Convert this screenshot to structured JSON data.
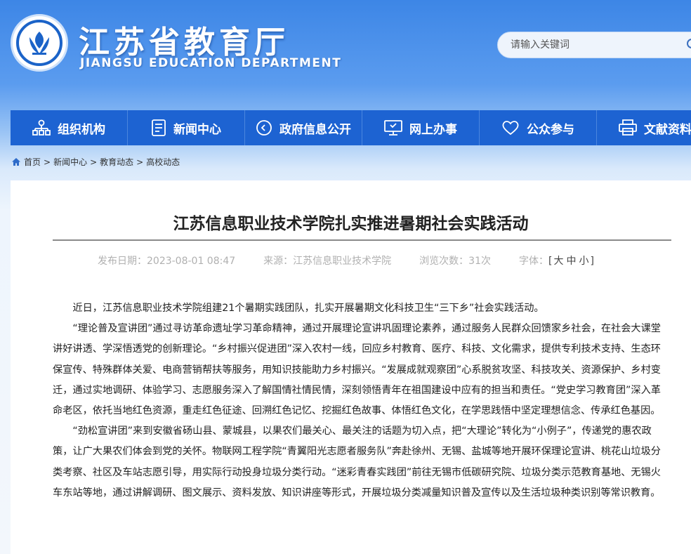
{
  "header": {
    "site_title": "江苏省教育厅",
    "site_subtitle": "JIANGSU EDUCATION DEPARTMENT",
    "search_placeholder": "请输入关键词"
  },
  "nav": [
    {
      "label": "组织机构",
      "icon": "org-chart-icon"
    },
    {
      "label": "新闻中心",
      "icon": "document-icon"
    },
    {
      "label": "政府信息公开",
      "icon": "play-circle-icon"
    },
    {
      "label": "网上办事",
      "icon": "monitor-icon"
    },
    {
      "label": "公众参与",
      "icon": "heart-icon"
    },
    {
      "label": "文献资料",
      "icon": "printer-icon"
    }
  ],
  "breadcrumb": {
    "items": [
      "首页",
      "新闻中心",
      "教育动态",
      "高校动态"
    ],
    "separator": ">"
  },
  "article": {
    "title": "江苏信息职业技术学院扎实推进暑期社会实践活动",
    "publish_label": "发布日期：",
    "publish_date": "2023-08-01 08:47",
    "source_label": "来源：",
    "source": "江苏信息职业技术学院",
    "views_label": "浏览次数：",
    "views": "31次",
    "font_label": "字体：",
    "font_sizes": [
      "大",
      "中",
      "小"
    ],
    "paragraphs": [
      "近日，江苏信息职业技术学院组建21个暑期实践团队，扎实开展暑期文化科技卫生“三下乡”社会实践活动。",
      "“理论普及宣讲团”通过寻访革命遗址学习革命精神，通过开展理论宣讲巩固理论素养，通过服务人民群众回馈家乡社会，在社会大课堂讲好讲透、学深悟透党的创新理论。“乡村振兴促进团”深入农村一线，回应乡村教育、医疗、科技、文化需求，提供专利技术支持、生态环保宣传、特殊群体关爱、电商营销帮扶等服务，用知识技能助力乡村振兴。“发展成就观察团”心系脱贫攻坚、科技攻关、资源保护、乡村变迁，通过实地调研、体验学习、志愿服务深入了解国情社情民情，深刻领悟青年在祖国建设中应有的担当和责任。“党史学习教育团”深入革命老区，依托当地红色资源，重走红色征途、回溯红色记忆、挖掘红色故事、体悟红色文化，在学思践悟中坚定理想信念、传承红色基因。",
      "“劲松宣讲团”来到安徽省砀山县、蒙城县，以果农们最关心、最关注的话题为切入点，把“大理论”转化为“小例子”，传递党的惠农政策，让广大果农们体会到党的关怀。物联网工程学院“青翼阳光志愿者服务队”奔赴徐州、无锡、盐城等地开展环保理论宣讲、桃花山垃圾分类考察、社区及车站志愿引导，用实际行动投身垃圾分类行动。“迷彩青春实践团”前往无锡市低碳研究院、垃圾分类示范教育基地、无锡火车东站等地，通过讲解调研、图文展示、资料发放、知识讲座等形式，开展垃圾分类减量知识普及宣传以及生活垃圾种类识别等常识教育。"
    ]
  },
  "colors": {
    "nav_bg": "#1d63d2",
    "header_blue": "#3d86e6",
    "meta_gray": "#b0b0b0"
  }
}
